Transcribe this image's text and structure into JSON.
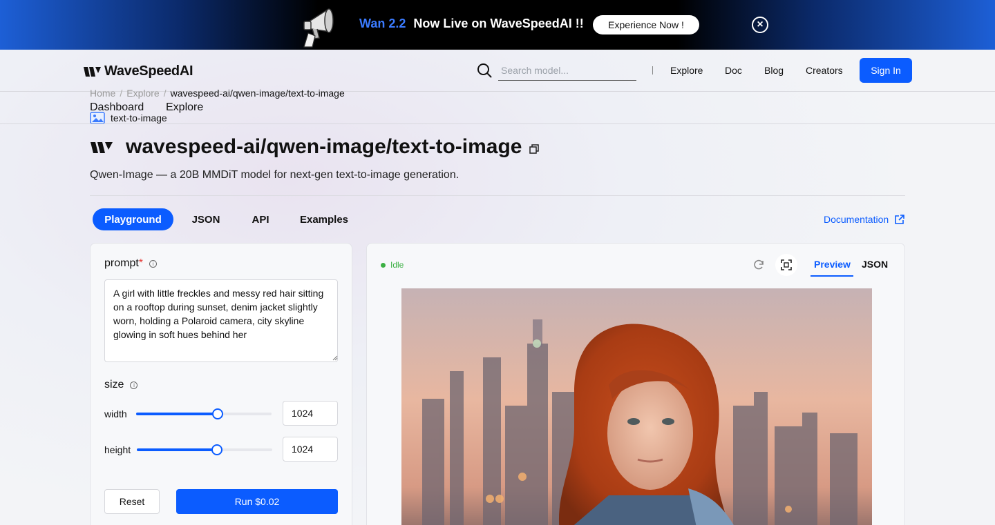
{
  "banner": {
    "accent": "Wan 2.2",
    "text": "Now Live on WaveSpeedAI !!",
    "cta_label": "Experience Now !",
    "close_icon": "close-circle-icon"
  },
  "header": {
    "brand": "WaveSpeedAI",
    "search_placeholder": "Search model...",
    "nav": [
      "Explore",
      "Doc",
      "Blog",
      "Creators"
    ],
    "signin_label": "Sign In"
  },
  "breadcrumb": {
    "items": [
      "Home",
      "Explore",
      "wavespeed-ai/qwen-image/text-to-image"
    ],
    "separator": "/"
  },
  "subnav": [
    "Dashboard",
    "Explore"
  ],
  "model": {
    "category": "text-to-image",
    "title": "wavespeed-ai/qwen-image/text-to-image",
    "description": "Qwen-Image — a 20B MMDiT model for next-gen text-to-image generation."
  },
  "tabs": [
    "Playground",
    "JSON",
    "API",
    "Examples"
  ],
  "active_tab": "Playground",
  "documentation_label": "Documentation",
  "form": {
    "prompt_label": "prompt",
    "required_mark": "*",
    "prompt_value": "A girl with little freckles and messy red hair sitting on a rooftop during sunset, denim jacket slightly worn, holding a Polaroid camera, city skyline glowing in soft hues behind her",
    "size_label": "size",
    "width_label": "width",
    "width_value": "1024",
    "width_fraction": 0.6,
    "height_label": "height",
    "height_value": "1024",
    "height_fraction": 0.59,
    "reset_label": "Reset",
    "run_label": "Run $0.02"
  },
  "output": {
    "status": "Idle",
    "view_tabs": [
      "Preview",
      "JSON"
    ],
    "active_view": "Preview"
  },
  "colors": {
    "accent": "#0b5cff",
    "status_green": "#3cb043",
    "required_red": "#e53935"
  }
}
